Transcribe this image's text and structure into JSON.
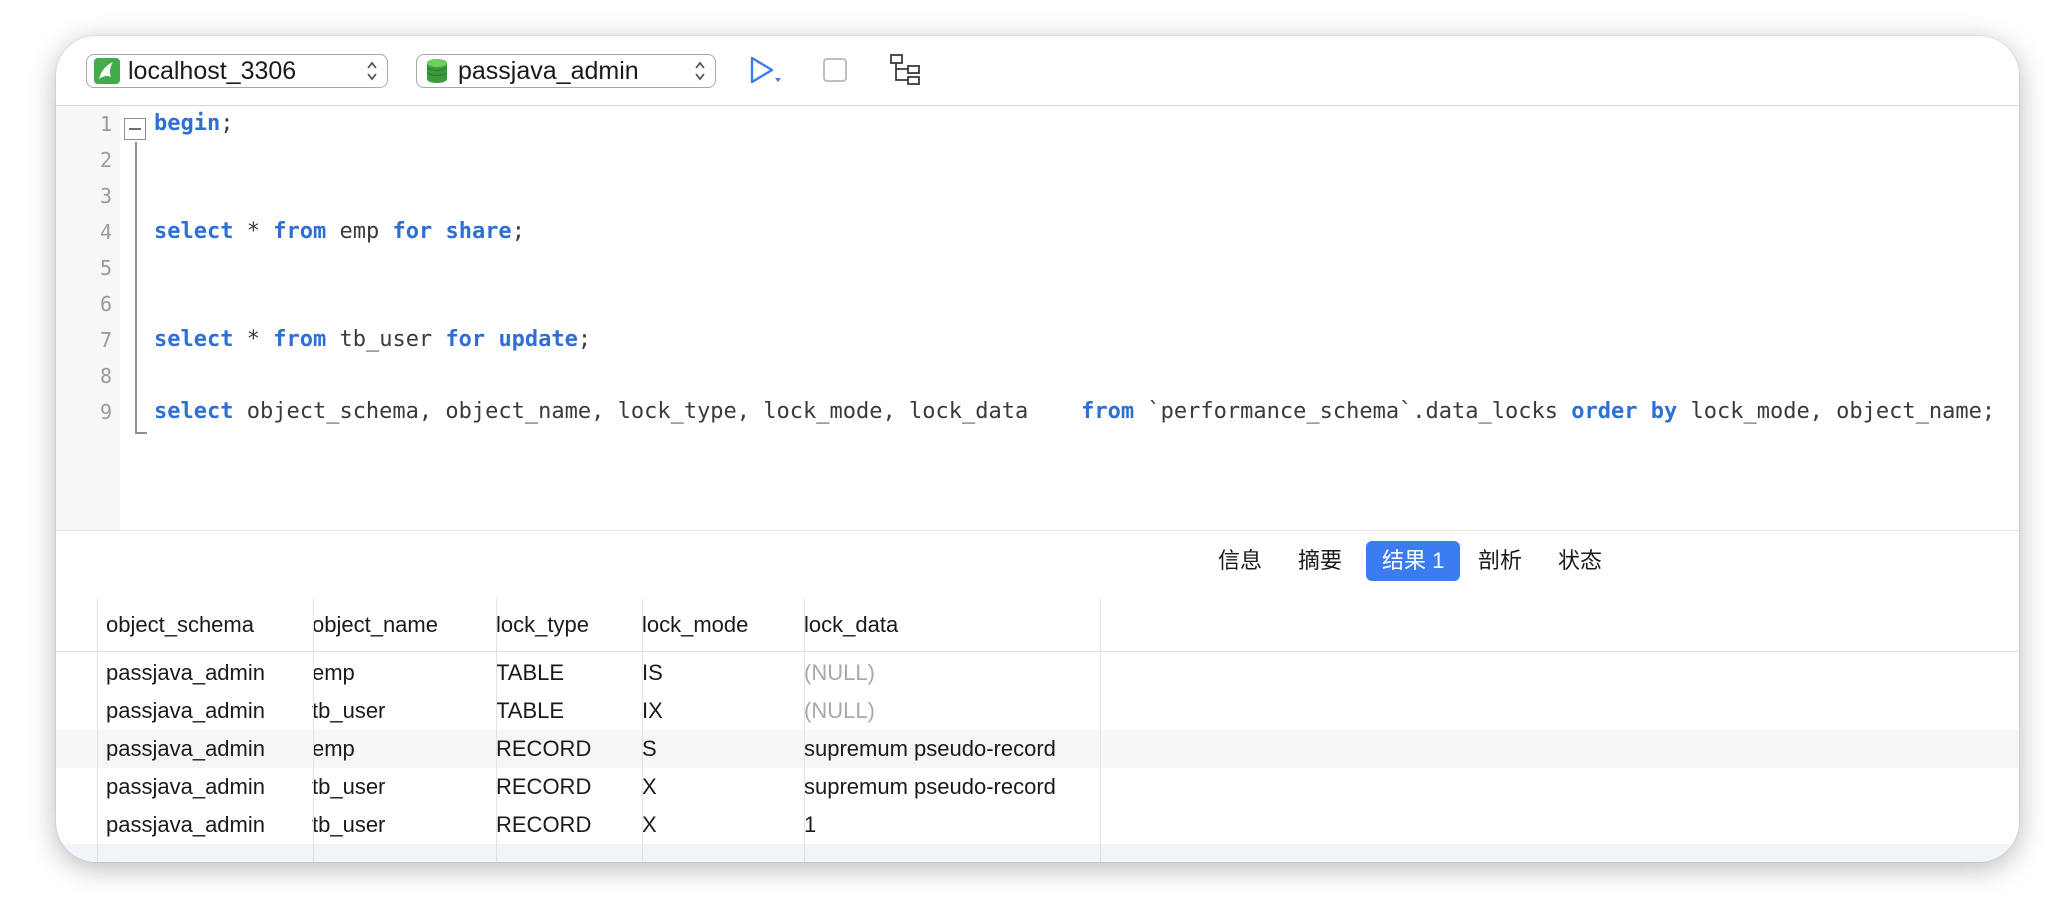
{
  "toolbar": {
    "connection": "localhost_3306",
    "database": "passjava_admin",
    "connection_icon": "mysql-dolphin-icon",
    "database_icon": "database-cylinder-icon",
    "run_icon": "play-icon",
    "stop_icon": "stop-icon",
    "explain_icon": "explain-tree-icon"
  },
  "editor": {
    "line_numbers": [
      "1",
      "2",
      "3",
      "4",
      "5",
      "6",
      "7",
      "8",
      "9"
    ],
    "lines": {
      "l1": {
        "kw1": "begin",
        "t1": ";"
      },
      "l4": {
        "kw1": "select",
        "t1": " * ",
        "kw2": "from",
        "t2": " emp ",
        "kw3": "for",
        "t3": " ",
        "kw4": "share",
        "t4": ";"
      },
      "l7": {
        "kw1": "select",
        "t1": " * ",
        "kw2": "from",
        "t2": " tb_user ",
        "kw3": "for",
        "t3": " ",
        "kw4": "update",
        "t4": ";"
      },
      "l9": {
        "kw1": "select",
        "t1": " object_schema, object_name, lock_type, lock_mode, lock_data    ",
        "kw2": "from",
        "t2": " `performance_schema`.data_locks ",
        "kw3": "order",
        "t3": " ",
        "kw4": "by",
        "t4": " lock_mode, object_name;"
      }
    }
  },
  "result_tabs": [
    "信息",
    "摘要",
    "结果 1",
    "剖析",
    "状态"
  ],
  "active_tab": "结果 1",
  "grid": {
    "columns": [
      "object_schema",
      "object_name",
      "lock_type",
      "lock_mode",
      "lock_data"
    ],
    "rows": [
      [
        "passjava_admin",
        "emp",
        "TABLE",
        "IS",
        "(NULL)"
      ],
      [
        "passjava_admin",
        "tb_user",
        "TABLE",
        "IX",
        "(NULL)"
      ],
      [
        "passjava_admin",
        "emp",
        "RECORD",
        "S",
        "supremum pseudo-record"
      ],
      [
        "passjava_admin",
        "tb_user",
        "RECORD",
        "X",
        "supremum pseudo-record"
      ],
      [
        "passjava_admin",
        "tb_user",
        "RECORD",
        "X",
        "1"
      ]
    ]
  },
  "colors": {
    "keyword": "#2e6fd6",
    "active_tab": "#3b7cf0",
    "run_button": "#3b7cf0",
    "null_text": "#a8a8a8"
  }
}
